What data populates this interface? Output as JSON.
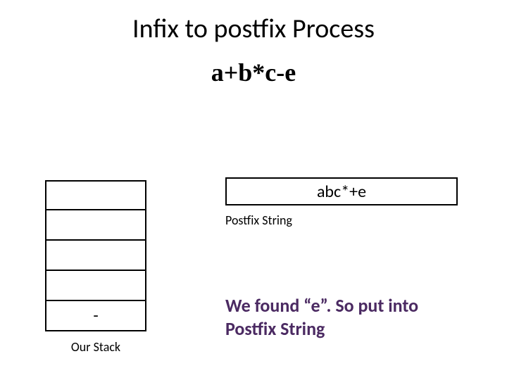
{
  "title": "Infix to postfix Process",
  "expression": "a+b*c-e",
  "stack": {
    "cells": [
      "",
      "",
      "",
      "",
      "-"
    ],
    "label": "Our Stack"
  },
  "postfix": {
    "value": "abc*+e",
    "label": "Postfix String"
  },
  "explanation": "We found “e”. So put into Postfix String"
}
